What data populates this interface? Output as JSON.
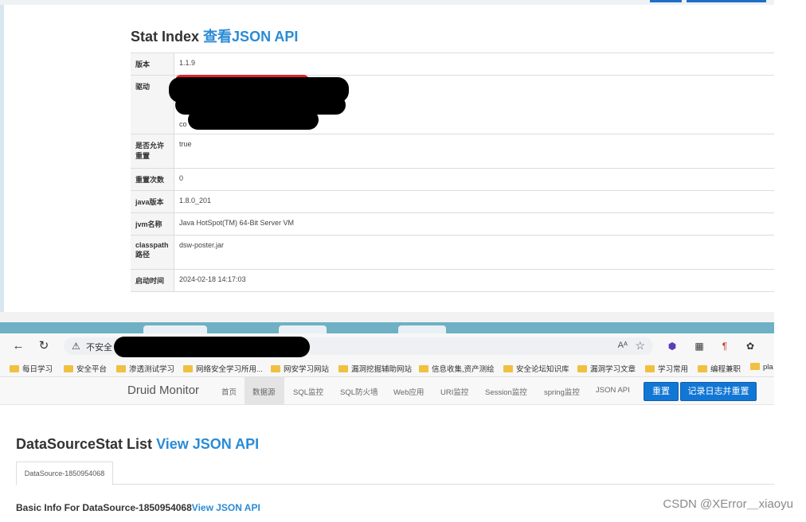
{
  "stat_index": {
    "title": "Stat Index",
    "link": "查看JSON API",
    "rows": [
      {
        "key": "版本",
        "value": "1.1.9"
      },
      {
        "key": "驱动",
        "value": "co"
      },
      {
        "key": "是否允许重置",
        "value": "true"
      },
      {
        "key": "重置次数",
        "value": "0"
      },
      {
        "key": "java版本",
        "value": "1.8.0_201"
      },
      {
        "key": "jvm名称",
        "value": "Java HotSpot(TM) 64-Bit Server VM"
      },
      {
        "key": "classpath路径",
        "value": "dsw-poster.jar"
      },
      {
        "key": "启动时间",
        "value": "2024-02-18 14:17:03"
      }
    ]
  },
  "browser": {
    "address_warning": "不安全",
    "reader_label": "Aᴬ",
    "bookmarks": [
      "每日学习",
      "安全平台",
      "渗透测试学习",
      "网络安全学习所用...",
      "网安学习网站",
      "漏洞挖掘辅助网站",
      "信息收集,资产测绘",
      "安全论坛知识库",
      "漏洞学习文章",
      "学习常用",
      "编程兼职",
      "pla"
    ]
  },
  "druid_nav": {
    "brand": "Druid Monitor",
    "items": [
      "首页",
      "数据源",
      "SQL监控",
      "SQL防火墙",
      "Web应用",
      "URI监控",
      "Session监控",
      "spring监控",
      "JSON API"
    ],
    "reset_button": "重置",
    "log_reset_button": "记录日志并重置"
  },
  "datasource": {
    "title": "DataSourceStat List",
    "link": "View JSON API",
    "tab": "DataSource-1850954068",
    "basic_info": "Basic Info For DataSource-1850954068",
    "basic_info_link": "View JSON API"
  },
  "watermark": "CSDN @XError＿xiaoyu"
}
